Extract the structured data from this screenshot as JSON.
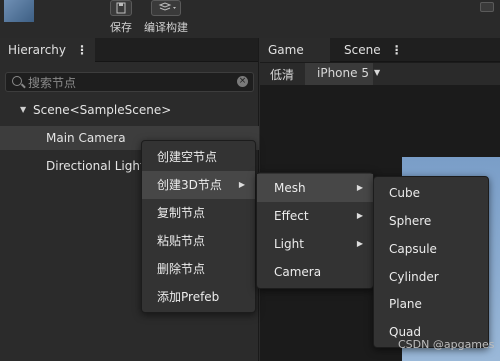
{
  "toolbar": {
    "save_label": "保存",
    "build_label": "编译构建"
  },
  "hierarchy": {
    "tab_label": "Hierarchy",
    "menu_glyph": "⋮",
    "search_placeholder": "搜索节点",
    "tree": {
      "scene": "Scene<SampleScene>",
      "nodes": [
        "Main Camera",
        "Directional Light"
      ]
    }
  },
  "preview": {
    "tabs": [
      "Game",
      "Scene"
    ],
    "quality": "低清",
    "device": "iPhone 5"
  },
  "context_menu": {
    "items": [
      "创建空节点",
      "创建3D节点",
      "复制节点",
      "粘贴节点",
      "删除节点",
      "添加Prefeb"
    ]
  },
  "submenu_3d": {
    "items": [
      "Mesh",
      "Effect",
      "Light",
      "Camera"
    ]
  },
  "submenu_mesh": {
    "items": [
      "Cube",
      "Sphere",
      "Capsule",
      "Cylinder",
      "Plane",
      "Quad"
    ]
  },
  "watermark": "CSDN @apgames",
  "colors": {
    "panel_bg": "#2b2b2b",
    "menu_bg": "#333333",
    "highlight": "#474747"
  }
}
